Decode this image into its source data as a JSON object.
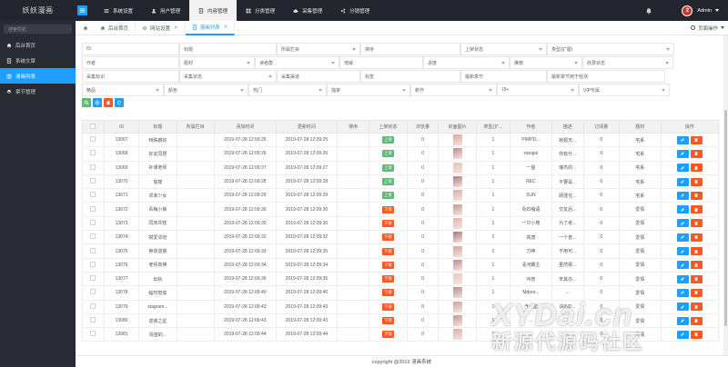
{
  "app": {
    "logo": "妖妖漫画"
  },
  "topnav": [
    {
      "label": "系统设置",
      "icon": "list-icon",
      "active": false
    },
    {
      "label": "用户管理",
      "icon": "user-icon",
      "active": false
    },
    {
      "label": "内容管理",
      "icon": "document-icon",
      "active": true
    },
    {
      "label": "分类管理",
      "icon": "grid-icon",
      "active": false
    },
    {
      "label": "采集管理",
      "icon": "cloud-icon",
      "active": false
    },
    {
      "label": "分销管理",
      "icon": "share-icon",
      "active": false
    }
  ],
  "user": {
    "avatar_text": "2",
    "name": "Admin"
  },
  "sidebar": {
    "search_placeholder": "搜索导航",
    "items": [
      {
        "label": "后台首页",
        "active": false
      },
      {
        "label": "系统文章",
        "active": false
      },
      {
        "label": "漫画列表",
        "active": true
      },
      {
        "label": "章节管理",
        "active": false
      }
    ]
  },
  "tabs": [
    {
      "label": "后台首页",
      "closable": false,
      "active": false
    },
    {
      "label": "网站设置",
      "closable": true,
      "active": false
    },
    {
      "label": "漫画列表",
      "closable": true,
      "active": true
    }
  ],
  "page_ops": "页面操作",
  "filters": {
    "row1": [
      "ID",
      "标题",
      "所属栏目",
      "排序",
      "上架状态",
      "类型(扩展)"
    ],
    "row2": [
      "作者",
      "题材",
      "读者群",
      "地域",
      "进度",
      "推荐",
      "收费状态"
    ],
    "row3": [
      "采集标识",
      "采集状态",
      "采集渠道",
      "标签",
      "最新章节",
      "最新章节用于检测"
    ],
    "row4": [
      "精品",
      "颜色",
      "热门",
      "独家",
      "新作",
      "18+",
      "VIP专属"
    ]
  },
  "table": {
    "headers": [
      "",
      "ID",
      "标题",
      "所属栏目",
      "添加时间",
      "更新时间",
      "排序",
      "上架状态",
      "浏览量",
      "封面图片",
      "类型(扩...",
      "作者",
      "描述",
      "订阅量",
      "题材",
      "操作"
    ],
    "rows": [
      {
        "id": "13067",
        "title": "特殊癖好",
        "add": "2019-07-28 12:09:25",
        "upd": "2019-07-28 12:09:25",
        "status": "上架",
        "views": "0",
        "type": "1",
        "author": "PIMPD...",
        "desc": "她裂天...",
        "subs": "0",
        "genre": "宅系"
      },
      {
        "id": "13068",
        "title": "好友同居",
        "add": "2019-07-28 12:09:26",
        "upd": "2019-07-28 12:09:26",
        "status": "上架",
        "views": "0",
        "type": "1",
        "author": "xiaogui",
        "desc": "你有什...",
        "subs": "0",
        "genre": "宅系"
      },
      {
        "id": "13069",
        "title": "补课老师",
        "add": "2019-07-28 12:09:27",
        "upd": "2019-07-28 12:09:27",
        "status": "上架",
        "views": "0",
        "type": "1",
        "author": "一屋",
        "desc": "瑞杰的...",
        "subs": "0",
        "genre": "宅系"
      },
      {
        "id": "13070",
        "title": "偷窥",
        "add": "2019-07-28 12:09:28",
        "upd": "2019-07-28 12:09:28",
        "status": "上架",
        "views": "0",
        "type": "1",
        "author": "REC",
        "desc": "不要是...",
        "subs": "0",
        "genre": "宅系"
      },
      {
        "id": "13071",
        "title": "邻家少女",
        "add": "2019-07-28 12:09:29",
        "upd": "2019-07-28 12:09:29",
        "status": "上架",
        "views": "0",
        "type": "1",
        "author": "SUN",
        "desc": "顾瑾住...",
        "subs": "0",
        "genre": "宅系"
      },
      {
        "id": "13072",
        "title": "青梅小姊",
        "add": "2019-07-28 12:09:30",
        "upd": "2019-07-28 12:09:30",
        "status": "下架",
        "views": "0",
        "type": "1",
        "author": "青石缩语",
        "desc": "交友后...",
        "subs": "0",
        "genre": "爱情"
      },
      {
        "id": "13073",
        "title": "同床共枕",
        "add": "2019-07-28 12:09:30",
        "upd": "2019-07-28 12:09:30",
        "status": "下架",
        "views": "0",
        "type": "1",
        "author": "一只小熊",
        "desc": "为了考...",
        "subs": "0",
        "genre": "爱情"
      },
      {
        "id": "13074",
        "title": "赋爱邻培",
        "add": "2019-07-28 12:09:32",
        "upd": "2019-07-28 12:09:32",
        "status": "下架",
        "views": "0",
        "type": "1",
        "author": "高唐",
        "desc": "一个普...",
        "subs": "0",
        "genre": "爱情"
      },
      {
        "id": "13075",
        "title": "换体逆袭",
        "add": "2019-07-28 12:09:33",
        "upd": "2019-07-28 12:09:35",
        "status": "下架",
        "views": "0",
        "type": "1",
        "author": "刀神",
        "desc": "不用可...",
        "subs": "0",
        "genre": "爱情"
      },
      {
        "id": "13076",
        "title": "老师真棒",
        "add": "2019-07-28 12:09:34",
        "upd": "2019-07-28 12:09:34",
        "status": "下架",
        "views": "0",
        "type": "1",
        "author": "清河霸主",
        "desc": "虽然那...",
        "subs": "0",
        "genre": "爱情"
      },
      {
        "id": "13077",
        "title": "出轨",
        "add": "2019-07-28 12:09:36",
        "upd": "2019-07-28 12:09:36",
        "status": "下架",
        "views": "0",
        "type": "1",
        "author": "叫普",
        "desc": "宋其办...",
        "subs": "0",
        "genre": "爱情"
      },
      {
        "id": "13078",
        "title": "临时借偷",
        "add": "2019-07-28 12:09:40",
        "upd": "2019-07-28 12:09:40",
        "status": "下架",
        "views": "0",
        "type": "1",
        "author": "Mdoor...",
        "desc": "...",
        "subs": "0",
        "genre": "爱情"
      },
      {
        "id": "13079",
        "title": "stagram...",
        "add": "2019-07-28 12:09:43",
        "upd": "2019-07-28 12:09:43",
        "status": "下架",
        "views": "0",
        "type": "1",
        "author": "汽水堂",
        "desc": "由IND...",
        "subs": "0",
        "genre": "爱情"
      },
      {
        "id": "13080",
        "title": "逆袭之星",
        "add": "2019-07-28 12:09:43",
        "upd": "2019-07-28 12:09:43",
        "status": "下架",
        "views": "0",
        "type": "1",
        "author": "...",
        "desc": "...",
        "subs": "0",
        "genre": "爱情"
      },
      {
        "id": "13081",
        "title": "渴望的...",
        "add": "2019-07-28 12:09:44",
        "upd": "2019-07-28 12:09:44",
        "status": "下架",
        "views": "0",
        "type": "1",
        "author": "...",
        "desc": "...",
        "subs": "0",
        "genre": "爱情"
      }
    ]
  },
  "footer": "copyright @2019 漫画系统",
  "watermark": {
    "line1": "XYDai.cn",
    "line2": "新源代源码社区"
  },
  "colors": {
    "accent": "#1e9fff",
    "dark": "#23262e",
    "sidebar": "#282b33",
    "on": "#5fb878",
    "off": "#ff5722"
  }
}
